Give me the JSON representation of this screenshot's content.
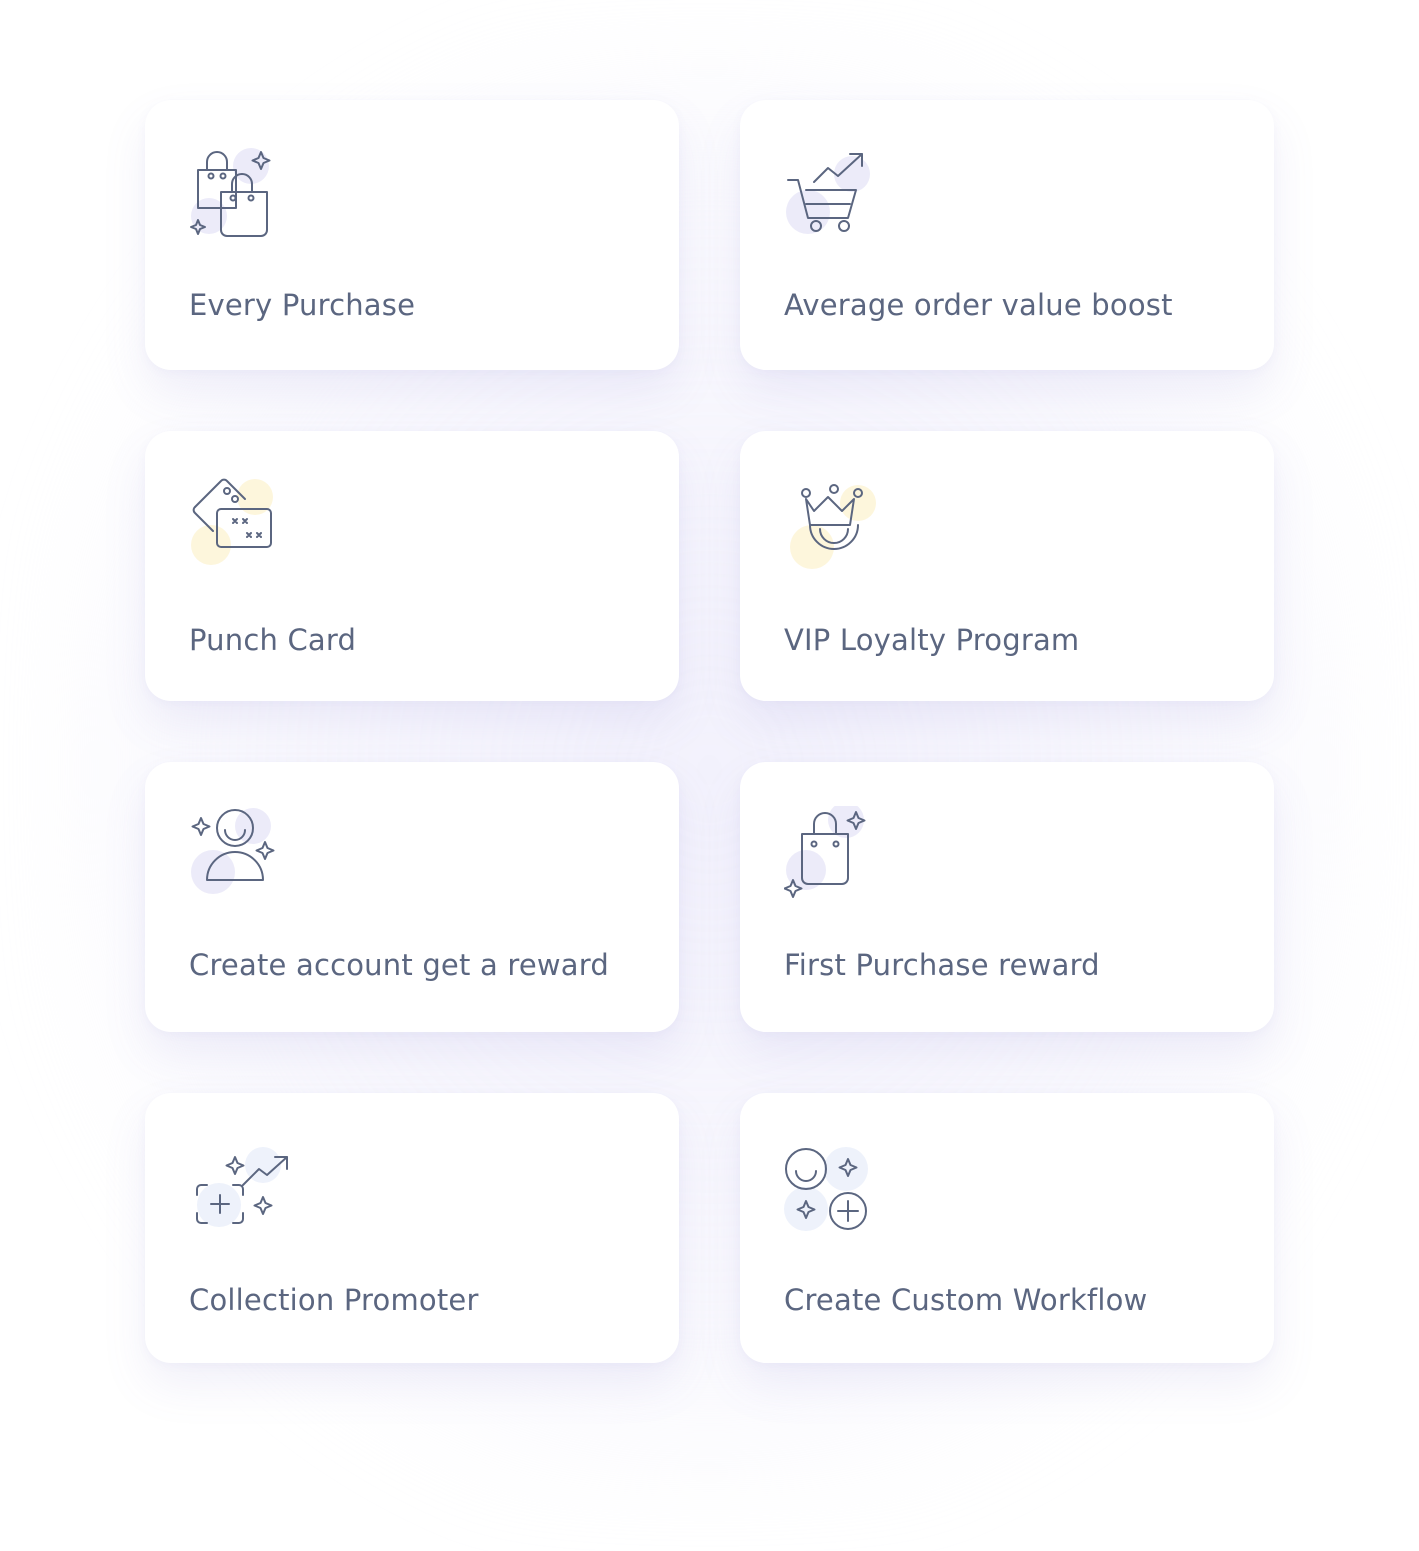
{
  "colors": {
    "text": "#5b6680",
    "icon_stroke": "#5b6680",
    "blob_lavender": "#ecebf9",
    "blob_yellow": "#fdf6dc",
    "blob_blue": "#eef2fb",
    "card_bg": "#ffffff"
  },
  "cards": [
    {
      "label": "Every Purchase",
      "icon": "shopping-bags-icon"
    },
    {
      "label": "Average order value boost",
      "icon": "cart-trend-icon"
    },
    {
      "label": "Punch Card",
      "icon": "punch-card-icon"
    },
    {
      "label": "VIP Loyalty Program",
      "icon": "crown-smile-icon"
    },
    {
      "label": "Create account get a reward",
      "icon": "user-sparkle-icon"
    },
    {
      "label": "First Purchase reward",
      "icon": "shopping-bag-icon"
    },
    {
      "label": "Collection Promoter",
      "icon": "collection-trend-icon"
    },
    {
      "label": "Create Custom Workflow",
      "icon": "workflow-icon"
    }
  ]
}
